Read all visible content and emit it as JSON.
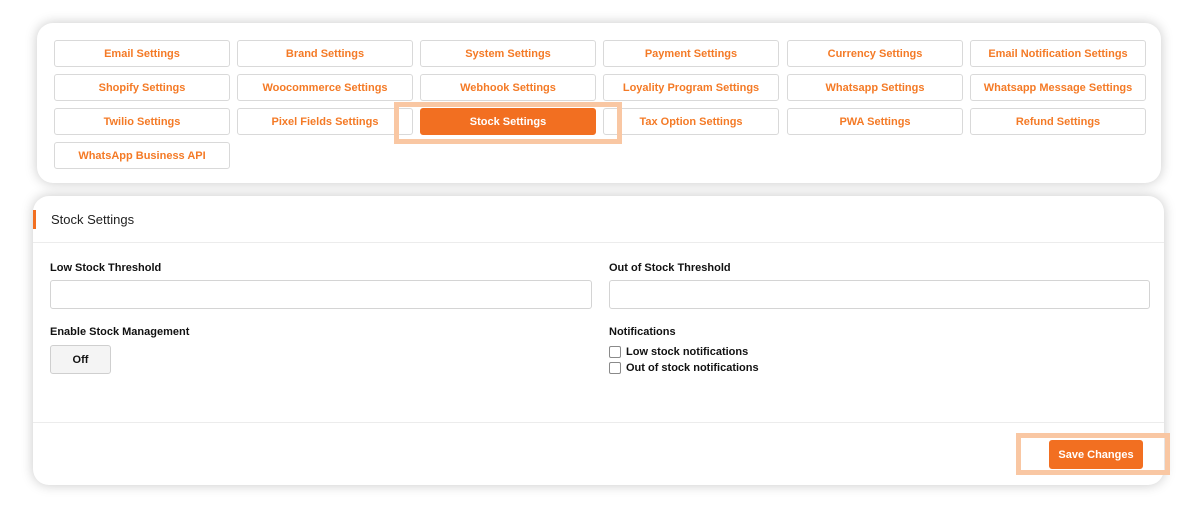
{
  "tabs": {
    "row1": [
      "Email Settings",
      "Brand Settings",
      "System Settings",
      "Payment Settings",
      "Currency Settings",
      "Email Notification Settings"
    ],
    "row2": [
      "Shopify Settings",
      "Woocommerce Settings",
      "Webhook Settings",
      "Loyality Program Settings",
      "Whatsapp Settings",
      "Whatsapp Message Settings"
    ],
    "row3": [
      "Twilio Settings",
      "Pixel Fields Settings",
      "Stock Settings",
      "Tax Option Settings",
      "PWA Settings",
      "Refund Settings"
    ],
    "row4": [
      "WhatsApp Business API"
    ],
    "active": "Stock Settings"
  },
  "panel": {
    "title": "Stock Settings",
    "low_stock_label": "Low Stock Threshold",
    "low_stock_value": "",
    "out_of_stock_label": "Out of Stock Threshold",
    "out_of_stock_value": "",
    "enable_label": "Enable Stock Management",
    "enable_value": "Off",
    "notifications_label": "Notifications",
    "notif_low": "Low stock notifications",
    "notif_out": "Out of stock notifications",
    "save_label": "Save Changes"
  },
  "colors": {
    "accent": "#f26f21",
    "highlight": "#f9c7a3"
  }
}
